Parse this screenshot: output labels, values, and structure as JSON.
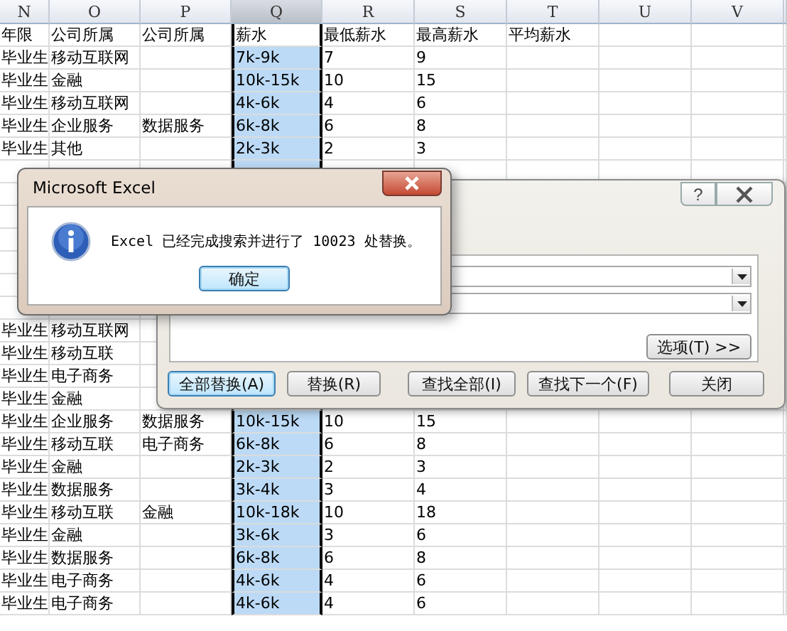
{
  "columns": [
    {
      "label": "N",
      "selected": false
    },
    {
      "label": "O",
      "selected": false
    },
    {
      "label": "P",
      "selected": false
    },
    {
      "label": "Q",
      "selected": true
    },
    {
      "label": "R",
      "selected": false
    },
    {
      "label": "S",
      "selected": false
    },
    {
      "label": "T",
      "selected": false
    },
    {
      "label": "U",
      "selected": false
    },
    {
      "label": "V",
      "selected": false
    }
  ],
  "rows": [
    {
      "active": true,
      "cells": {
        "N": "年限",
        "O": "公司所属",
        "P": "公司所属",
        "Q": "薪水",
        "R": "最低薪水",
        "S": "最高薪水",
        "T": "平均薪水"
      }
    },
    {
      "active": false,
      "cells": {
        "N": "毕业生",
        "O": "移动互联网",
        "Q": "7k-9k",
        "R": "7",
        "S": "9"
      }
    },
    {
      "active": false,
      "cells": {
        "N": "毕业生",
        "O": "金融",
        "Q": "10k-15k",
        "R": "10",
        "S": "15"
      }
    },
    {
      "active": false,
      "cells": {
        "N": "毕业生",
        "O": "移动互联网",
        "Q": "4k-6k",
        "R": "4",
        "S": "6"
      }
    },
    {
      "active": false,
      "cells": {
        "N": "毕业生",
        "O": "企业服务",
        "P": "数据服务",
        "Q": "6k-8k",
        "R": "6",
        "S": "8"
      }
    },
    {
      "active": false,
      "cells": {
        "N": "毕业生",
        "O": "其他",
        "Q": "2k-3k",
        "R": "2",
        "S": "3"
      }
    },
    {
      "cells": {}
    },
    {
      "cells": {}
    },
    {
      "cells": {}
    },
    {
      "cells": {}
    },
    {
      "cells": {}
    },
    {
      "cells": {}
    },
    {
      "cells": {}
    },
    {
      "cells": {
        "N": "毕业生",
        "O": "移动互联网"
      }
    },
    {
      "cells": {
        "N": "毕业生",
        "O": "移动互联"
      }
    },
    {
      "cells": {
        "N": "毕业生",
        "O": "电子商务"
      }
    },
    {
      "cells": {
        "N": "毕业生",
        "O": "金融"
      }
    },
    {
      "active": false,
      "cells": {
        "N": "毕业生",
        "O": "企业服务",
        "P": "数据服务",
        "Q": "10k-15k",
        "R": "10",
        "S": "15"
      }
    },
    {
      "active": false,
      "cells": {
        "N": "毕业生",
        "O": "移动互联",
        "P": "电子商务",
        "Q": "6k-8k",
        "R": "6",
        "S": "8"
      }
    },
    {
      "active": false,
      "cells": {
        "N": "毕业生",
        "O": "金融",
        "Q": "2k-3k",
        "R": "2",
        "S": "3"
      }
    },
    {
      "active": false,
      "cells": {
        "N": "毕业生",
        "O": "数据服务",
        "Q": "3k-4k",
        "R": "3",
        "S": "4"
      }
    },
    {
      "active": false,
      "cells": {
        "N": "毕业生",
        "O": "移动互联",
        "P": "金融",
        "Q": "10k-18k",
        "R": "10",
        "S": "18"
      }
    },
    {
      "active": false,
      "cells": {
        "N": "毕业生",
        "O": "金融",
        "Q": "3k-6k",
        "R": "3",
        "S": "6"
      }
    },
    {
      "active": false,
      "cells": {
        "N": "毕业生",
        "O": "数据服务",
        "Q": "6k-8k",
        "R": "6",
        "S": "8"
      }
    },
    {
      "active": false,
      "cells": {
        "N": "毕业生",
        "O": "电子商务",
        "Q": "4k-6k",
        "R": "4",
        "S": "6"
      }
    },
    {
      "active": false,
      "cells": {
        "N": "毕业生",
        "O": "电子商务",
        "Q": "4k-6k",
        "R": "4",
        "S": "6"
      }
    }
  ],
  "replace_dialog": {
    "help": "?",
    "fields": [
      {
        "kind": "dropdown"
      },
      {
        "kind": "dropdown"
      }
    ],
    "options_button": "选项(T) >>",
    "buttons": [
      {
        "label": "全部替换(A)",
        "focused": true
      },
      {
        "label": "替换(R)",
        "focused": false
      },
      {
        "label": "查找全部(I)",
        "focused": false
      },
      {
        "label": "查找下一个(F)",
        "focused": false
      },
      {
        "label": "关闭",
        "focused": false
      }
    ]
  },
  "message_box": {
    "title": "Microsoft Excel",
    "message": "Excel 已经完成搜索并进行了 10023 处替换。",
    "buttons": [
      {
        "label": "确定",
        "focused": true
      }
    ]
  }
}
